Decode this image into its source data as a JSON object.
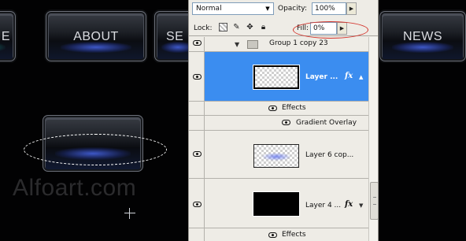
{
  "canvas": {
    "nav_buttons": [
      {
        "label": "ME"
      },
      {
        "label": "ABOUT"
      },
      {
        "label": "SE"
      },
      {
        "label": "NEWS"
      }
    ],
    "watermark": "Alfoart.com"
  },
  "layers_panel": {
    "blend_mode": "Normal",
    "opacity_label": "Opacity:",
    "opacity_value": "100%",
    "lock_label": "Lock:",
    "fill_label": "Fill:",
    "fill_value": "0%",
    "highlight_color": "#d3322a",
    "selection_color": "#3b8df0",
    "group": {
      "name": "Group 1 copy 23"
    },
    "layers": [
      {
        "name": "Layer ...",
        "has_fx": true,
        "selected": true,
        "thumbnail": "transparent"
      },
      {
        "name": "Layer 6 cop...",
        "has_fx": false,
        "selected": false,
        "thumbnail": "blue-glow"
      },
      {
        "name": "Layer 4 ...",
        "has_fx": true,
        "selected": false,
        "thumbnail": "black"
      }
    ],
    "effects_label": "Effects",
    "effect_item": "Gradient Overlay",
    "fx_symbol": "fx"
  }
}
